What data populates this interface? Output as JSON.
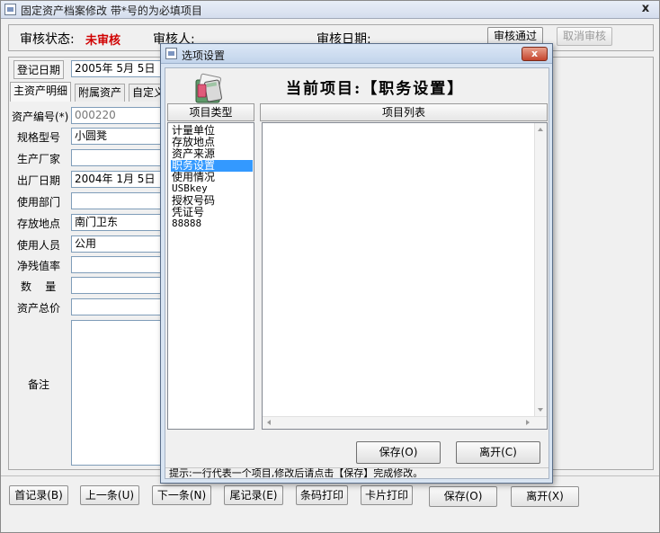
{
  "main_window": {
    "title": "固定资产档案修改 带*号的为必填项目",
    "close_symbol": "x"
  },
  "audit": {
    "status_label": "审核状态:",
    "status_value": "未审核",
    "auditor_label": "审核人:",
    "date_label": "审核日期:",
    "approve_button": "审核通过",
    "cancel_button": "取消审核"
  },
  "form": {
    "reg_date_label": "登记日期",
    "reg_date_value": "2005年  5月  5日",
    "tabs": [
      "主资产明细",
      "附属资产",
      "自定义"
    ],
    "fields": [
      {
        "label": "资产编号(*)",
        "value": "000220"
      },
      {
        "label": "规格型号",
        "value": "小圆凳"
      },
      {
        "label": "生产厂家",
        "value": ""
      },
      {
        "label": "出厂日期",
        "value": "2004年  1月  5日"
      },
      {
        "label": "使用部门",
        "value": ""
      },
      {
        "label": "存放地点",
        "value": "南门卫东"
      },
      {
        "label": "使用人员",
        "value": "公用"
      },
      {
        "label": "净残值率",
        "value": ""
      },
      {
        "label": "数    量",
        "value": ""
      },
      {
        "label": "资产总价",
        "value": ""
      }
    ],
    "remark_label": "备注"
  },
  "bottom_buttons": {
    "first": "首记录(B)",
    "prev": "上一条(U)",
    "next": "下一条(N)",
    "last": "尾记录(E)",
    "barcode": "条码打印",
    "card": "卡片打印",
    "save": "保存(O)",
    "leave": "离开(X)"
  },
  "dialog": {
    "title": "选项设置",
    "close_symbol": "x",
    "current_item": "当前项目:【职务设置】",
    "type_header": "项目类型",
    "list_header": "项目列表",
    "types": [
      "计量单位",
      "存放地点",
      "资产来源",
      "职务设置",
      "使用情况",
      "USBkey",
      "授权号码",
      "凭证号",
      "88888"
    ],
    "selected_index": 3,
    "save_button": "保存(O)",
    "leave_button": "离开(C)",
    "hint": "提示:一行代表一个项目,修改后请点击【保存】完成修改。"
  }
}
